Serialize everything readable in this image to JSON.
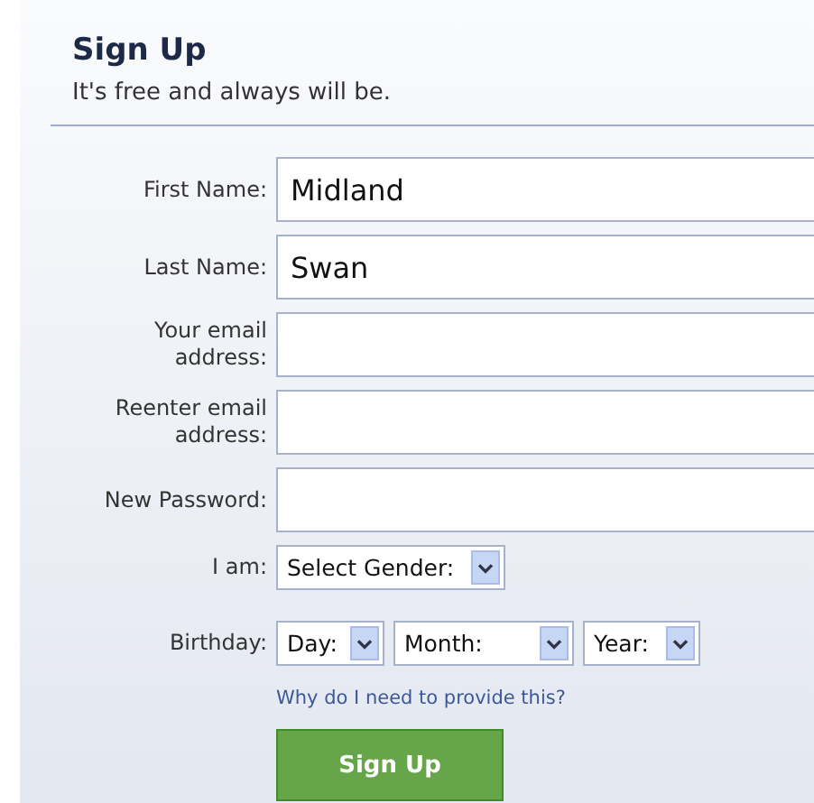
{
  "title": "Sign Up",
  "subtitle": "It's free and always will be.",
  "fields": [
    {
      "label": "First Name:",
      "value": "Midland"
    },
    {
      "label": "Last Name:",
      "value": "Swan"
    },
    {
      "label": "Your email address:"
    },
    {
      "label": "Reenter email address:"
    },
    {
      "label": "New Password:"
    }
  ],
  "gender": {
    "label": "I am:",
    "value": "Select Gender:"
  },
  "birthday": {
    "label": "Birthday:",
    "selects": [
      {
        "value": "Day:"
      },
      {
        "value": "Month:"
      },
      {
        "value": "Year:"
      }
    ]
  },
  "link": "Why do I need to provide this?",
  "button": "Sign Up"
}
